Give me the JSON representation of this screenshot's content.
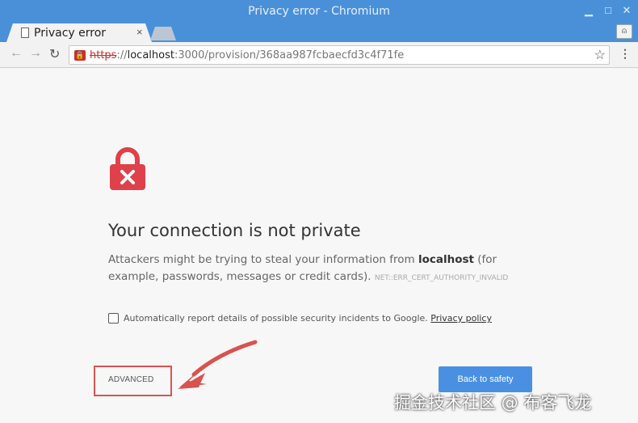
{
  "window": {
    "title": "Privacy error - Chromium"
  },
  "tab": {
    "title": "Privacy error",
    "close": "×"
  },
  "toolbar": {
    "url_scheme": "https",
    "url_sep": "://",
    "url_host": "localhost",
    "url_rest": ":3000/provision/368aa987fcbaecfd3c4f71fe"
  },
  "page": {
    "heading": "Your connection is not private",
    "desc_prefix": "Attackers might be trying to steal your information from ",
    "desc_host": "localhost",
    "desc_suffix": " (for example, passwords, messages or credit cards). ",
    "error_code": "NET::ERR_CERT_AUTHORITY_INVALID",
    "report_text": "Automatically report details of possible security incidents to Google. ",
    "privacy_link": "Privacy policy",
    "advanced_label": "ADVANCED",
    "back_label": "Back to safety"
  },
  "watermark": "掘金技术社区 @ 布客飞龙",
  "colors": {
    "titlebar": "#4a90d9",
    "lock": "#e0404a",
    "primary_button": "#4a90e2",
    "annotation": "#d9534f"
  }
}
